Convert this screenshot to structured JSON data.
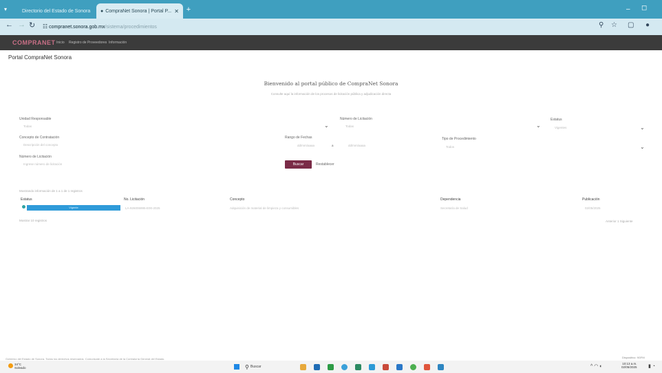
{
  "browser": {
    "tabs": [
      {
        "label": "Directorio del Estado de Sonora",
        "active": false
      },
      {
        "label": "CompraNet Sonora | Portal P...",
        "active": true
      }
    ],
    "url_host": "compranet.sonora.gob.mx",
    "url_path": "/sistema/procedimientos"
  },
  "site": {
    "logo": "COMPRANET",
    "nav": [
      "Inicio",
      "Registro de Proveedores",
      "Información"
    ]
  },
  "page": {
    "portal_title": "Portal CompraNet Sonora",
    "welcome": "Bienvenido al portal público de CompraNet Sonora",
    "subtitle": "Consulte aquí la información de los procesos de licitación pública y adjudicación directa",
    "filters": {
      "unidad_label": "Unidad Responsable",
      "unidad_value": "Todas",
      "numero_label": "Número de Licitación",
      "numero_value": "Todas",
      "estatus_label": "Estatus",
      "estatus_value": "Vigentes",
      "concepto_label": "Concepto de Contratación",
      "concepto_value": "Descripción del concepto",
      "rango_label": "Rango de Fechas",
      "fecha_inicio": "dd/mm/aaaa",
      "fecha_sep": "a",
      "fecha_fin": "dd/mm/aaaa",
      "tipo_label": "Tipo de Procedimiento",
      "tipo_value": "Todos",
      "nombre_label": "Número de Licitación",
      "nombre_value": "Ingrese número de licitación"
    },
    "buttons": {
      "buscar": "Buscar",
      "limpiar": "Restablecer"
    },
    "results_info": "Mostrando información de 1 a 1 de 1 registros",
    "table_headers": [
      "Estatus",
      "No. Licitación",
      "Concepto",
      "Dependencia",
      "Publicación"
    ],
    "row": {
      "estatus": "Vigente",
      "licitacion": "LA-926006995-E00-2025",
      "concepto": "Adquisición de material de limpieza y consumibles",
      "dependencia": "Secretaría de Salud",
      "publicacion": "02/05/2025"
    },
    "per_page": "Mostrar 10 registros",
    "pager": "Anterior  1  Siguiente",
    "footer_note": "Gobierno del Estado de Sonora. Todos los derechos reservados. Comunicate a la Secretaría de la Contraloría General del Estado."
  },
  "taskbar": {
    "weather_temp": "34°C",
    "weather_desc": "Soleado",
    "search_label": "Buscar",
    "clock_time": "10:13 a.m.",
    "clock_date": "02/05/2025",
    "notif_label": "Dispositivo: 9GFM"
  },
  "colors": {
    "browser_tab": "#3f9fbf",
    "navbar": "#3b3b3b",
    "accent_button": "#7a2b47",
    "status_bar": "#2f9bd9"
  }
}
